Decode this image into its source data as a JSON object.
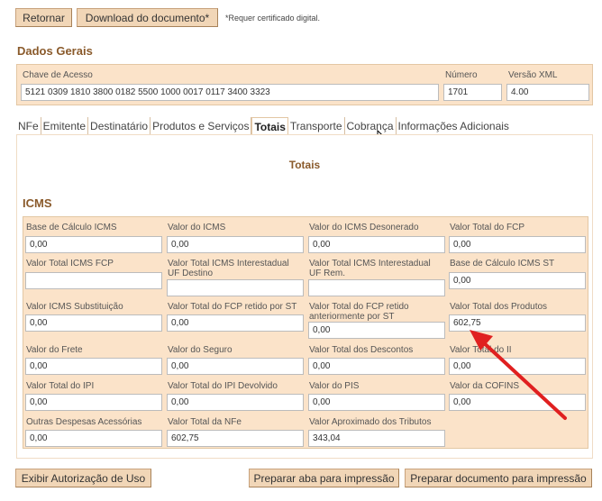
{
  "toolbar": {
    "back_label": "Retornar",
    "download_label": "Download do documento*",
    "cert_note": "*Requer certificado digital."
  },
  "general": {
    "section_title": "Dados Gerais",
    "chave_label": "Chave de Acesso",
    "chave_value": "5121 0309 1810 3800 0182 5500 1000 0017 0117 3400 3323",
    "numero_label": "Número",
    "numero_value": "1701",
    "versao_label": "Versão XML",
    "versao_value": "4.00"
  },
  "tabs": [
    {
      "label": "NFe"
    },
    {
      "label": "Emitente"
    },
    {
      "label": "Destinatário"
    },
    {
      "label": "Produtos e Serviços"
    },
    {
      "label": "Totais",
      "active": true
    },
    {
      "label": "Transporte"
    },
    {
      "label": "Cobrança"
    },
    {
      "label": "Informações Adicionais"
    }
  ],
  "totais": {
    "title": "Totais",
    "icms_title": "ICMS",
    "fields": [
      {
        "label": "Base de Cálculo ICMS",
        "value": "0,00"
      },
      {
        "label": "Valor do ICMS",
        "value": "0,00"
      },
      {
        "label": "Valor do ICMS Desonerado",
        "value": "0,00"
      },
      {
        "label": "Valor Total do FCP",
        "value": "0,00"
      },
      {
        "label": "Valor Total ICMS FCP",
        "value": ""
      },
      {
        "label": "Valor Total ICMS Interestadual UF Destino",
        "value": ""
      },
      {
        "label": "Valor Total ICMS Interestadual UF Rem.",
        "value": ""
      },
      {
        "label": "Base de Cálculo ICMS ST",
        "value": "0,00"
      },
      {
        "label": "Valor ICMS Substituição",
        "value": "0,00"
      },
      {
        "label": "Valor Total do FCP retido por ST",
        "value": "0,00"
      },
      {
        "label": "Valor Total do FCP retido anteriormente por ST",
        "value": "0,00"
      },
      {
        "label": "Valor Total dos Produtos",
        "value": "602,75"
      },
      {
        "label": "Valor do Frete",
        "value": "0,00"
      },
      {
        "label": "Valor do Seguro",
        "value": "0,00"
      },
      {
        "label": "Valor Total dos Descontos",
        "value": "0,00"
      },
      {
        "label": "Valor Total do II",
        "value": "0,00"
      },
      {
        "label": "Valor Total do IPI",
        "value": "0,00"
      },
      {
        "label": "Valor Total do IPI Devolvido",
        "value": "0,00"
      },
      {
        "label": "Valor do PIS",
        "value": "0,00"
      },
      {
        "label": "Valor da COFINS",
        "value": "0,00"
      },
      {
        "label": "Outras Despesas Acessórias",
        "value": "0,00"
      },
      {
        "label": "Valor Total da NFe",
        "value": "602,75"
      },
      {
        "label": "Valor Aproximado dos Tributos",
        "value": "343,04"
      }
    ]
  },
  "footer": {
    "auth_label": "Exibir Autorização de Uso",
    "print_tab_label": "Preparar aba para impressão",
    "print_doc_label": "Preparar documento para impressão"
  },
  "colors": {
    "button_bg": "#f1d6b7",
    "panel_bg": "#fbe3c9",
    "title": "#8a5a2b",
    "annotation_arrow": "#e02020"
  }
}
